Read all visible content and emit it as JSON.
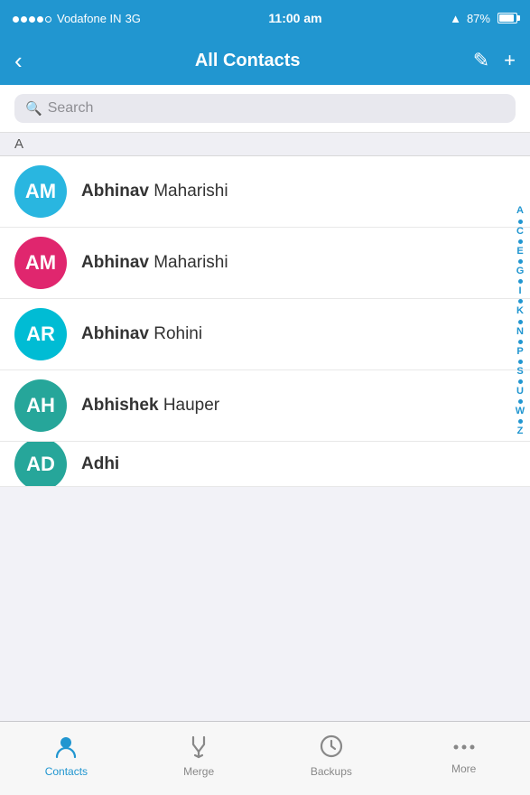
{
  "statusBar": {
    "carrier": "Vodafone IN",
    "network": "3G",
    "time": "11:00 am",
    "battery": "87%"
  },
  "navBar": {
    "title": "All Contacts",
    "backIcon": "‹",
    "editIcon": "✎",
    "addIcon": "+"
  },
  "search": {
    "placeholder": "Search"
  },
  "sectionA": {
    "label": "A"
  },
  "contacts": [
    {
      "initials": "AM",
      "firstName": "Abhinav",
      "lastName": "Maharishi",
      "avatarClass": "avatar-blue"
    },
    {
      "initials": "AM",
      "firstName": "Abhinav",
      "lastName": "Maharishi",
      "avatarClass": "avatar-pink"
    },
    {
      "initials": "AR",
      "firstName": "Abhinav",
      "lastName": "Rohini",
      "avatarClass": "avatar-cyan"
    },
    {
      "initials": "AH",
      "firstName": "Abhishek",
      "lastName": "Hauper",
      "avatarClass": "avatar-teal"
    },
    {
      "initials": "AD",
      "firstName": "Adhi",
      "lastName": "...",
      "avatarClass": "avatar-teal",
      "partial": true
    }
  ],
  "alphaIndex": [
    "A",
    "•",
    "C",
    "•",
    "E",
    "•",
    "G",
    "•",
    "I",
    "•",
    "K",
    "•",
    "N",
    "•",
    "P",
    "•",
    "S",
    "•",
    "U",
    "•",
    "W",
    "•",
    "Z"
  ],
  "tabs": [
    {
      "id": "contacts",
      "label": "Contacts",
      "active": true
    },
    {
      "id": "merge",
      "label": "Merge",
      "active": false
    },
    {
      "id": "backups",
      "label": "Backups",
      "active": false
    },
    {
      "id": "more",
      "label": "More",
      "active": false
    }
  ]
}
